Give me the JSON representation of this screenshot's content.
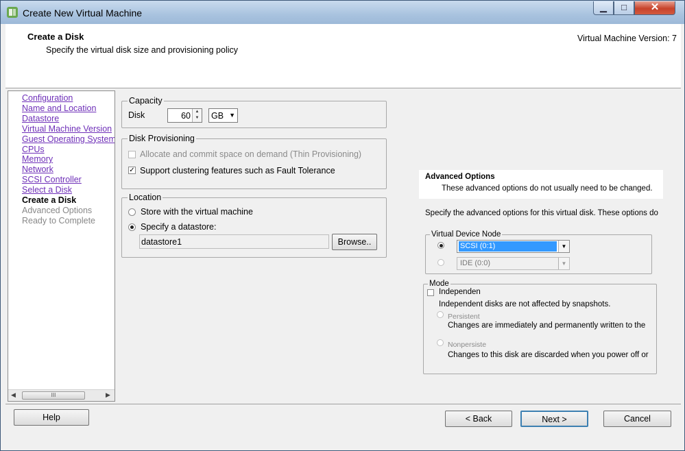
{
  "window": {
    "title": "Create New Virtual Machine",
    "min_label": "▁",
    "max_label": "□",
    "close_label": "✕"
  },
  "header": {
    "title": "Create a Disk",
    "subtitle": "Specify the virtual disk size and provisioning policy",
    "version": "Virtual Machine Version: 7"
  },
  "nav": {
    "items": [
      {
        "label": "Configuration",
        "state": "link"
      },
      {
        "label": "Name and Location",
        "state": "link"
      },
      {
        "label": "Datastore",
        "state": "link"
      },
      {
        "label": "Virtual Machine Version",
        "state": "link"
      },
      {
        "label": "Guest Operating System",
        "state": "link"
      },
      {
        "label": "CPUs",
        "state": "link"
      },
      {
        "label": "Memory",
        "state": "link"
      },
      {
        "label": "Network",
        "state": "link"
      },
      {
        "label": "SCSI Controller",
        "state": "link"
      },
      {
        "label": "Select a Disk",
        "state": "link"
      },
      {
        "label": "Create a Disk",
        "state": "current"
      },
      {
        "label": "Advanced Options",
        "state": "disabled"
      },
      {
        "label": "Ready to Complete",
        "state": "disabled"
      }
    ],
    "scroll_thumb": "III"
  },
  "capacity": {
    "legend": "Capacity",
    "disk_label": "Disk",
    "disk_size": "60",
    "unit": "GB"
  },
  "provisioning": {
    "legend": "Disk Provisioning",
    "thin_label": "Allocate and commit space on demand (Thin Provisioning)",
    "thin_checked": false,
    "ft_label": "Support clustering features such as Fault Tolerance",
    "ft_checked": true
  },
  "location": {
    "legend": "Location",
    "store_with_vm": "Store with the virtual machine",
    "specify_datastore": "Specify a datastore:",
    "datastore_value": "datastore1",
    "browse_label": "Browse.."
  },
  "advanced": {
    "title": "Advanced Options",
    "subtitle": "These advanced options do not usually need to be changed.",
    "description": "Specify the advanced options for this virtual disk. These options do",
    "vdn_legend": "Virtual Device Node",
    "scsi_value": "SCSI (0:1)",
    "ide_value": "IDE (0:0)",
    "mode_legend": "Mode",
    "independent_label": "Independen",
    "independent_desc": "Independent disks are not affected by snapshots.",
    "persistent_label": "Persistent",
    "persistent_desc": "Changes are immediately and permanently written to the",
    "nonpersistent_label": "Nonpersiste",
    "nonpersistent_desc": "Changes to this disk are discarded when you power off or"
  },
  "footer": {
    "help": "Help",
    "back": "< Back",
    "next": "Next >",
    "cancel": "Cancel"
  }
}
